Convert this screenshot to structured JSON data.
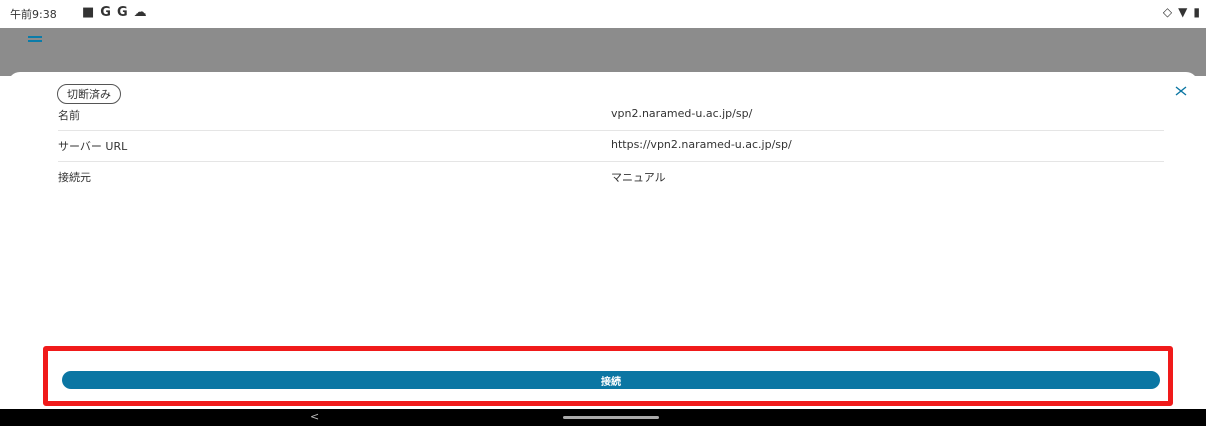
{
  "status_bar": {
    "time": "午前9:38",
    "left_icons": [
      "■",
      "G",
      "G",
      "☁"
    ],
    "right_icons": [
      "◇",
      "▼",
      "▮"
    ]
  },
  "sheet": {
    "badge": "切断済み",
    "rows": [
      {
        "label": "名前",
        "value": "vpn2.naramed-u.ac.jp/sp/"
      },
      {
        "label": "サーバー URL",
        "value": "https://vpn2.naramed-u.ac.jp/sp/"
      },
      {
        "label": "接続元",
        "value": "マニュアル"
      }
    ]
  },
  "actions": {
    "connect_label": "接続"
  },
  "nav": {
    "back": "<"
  },
  "colors": {
    "accent": "#0b76a3",
    "highlight": "#f01a1a",
    "appbar": "#8c8c8c"
  }
}
